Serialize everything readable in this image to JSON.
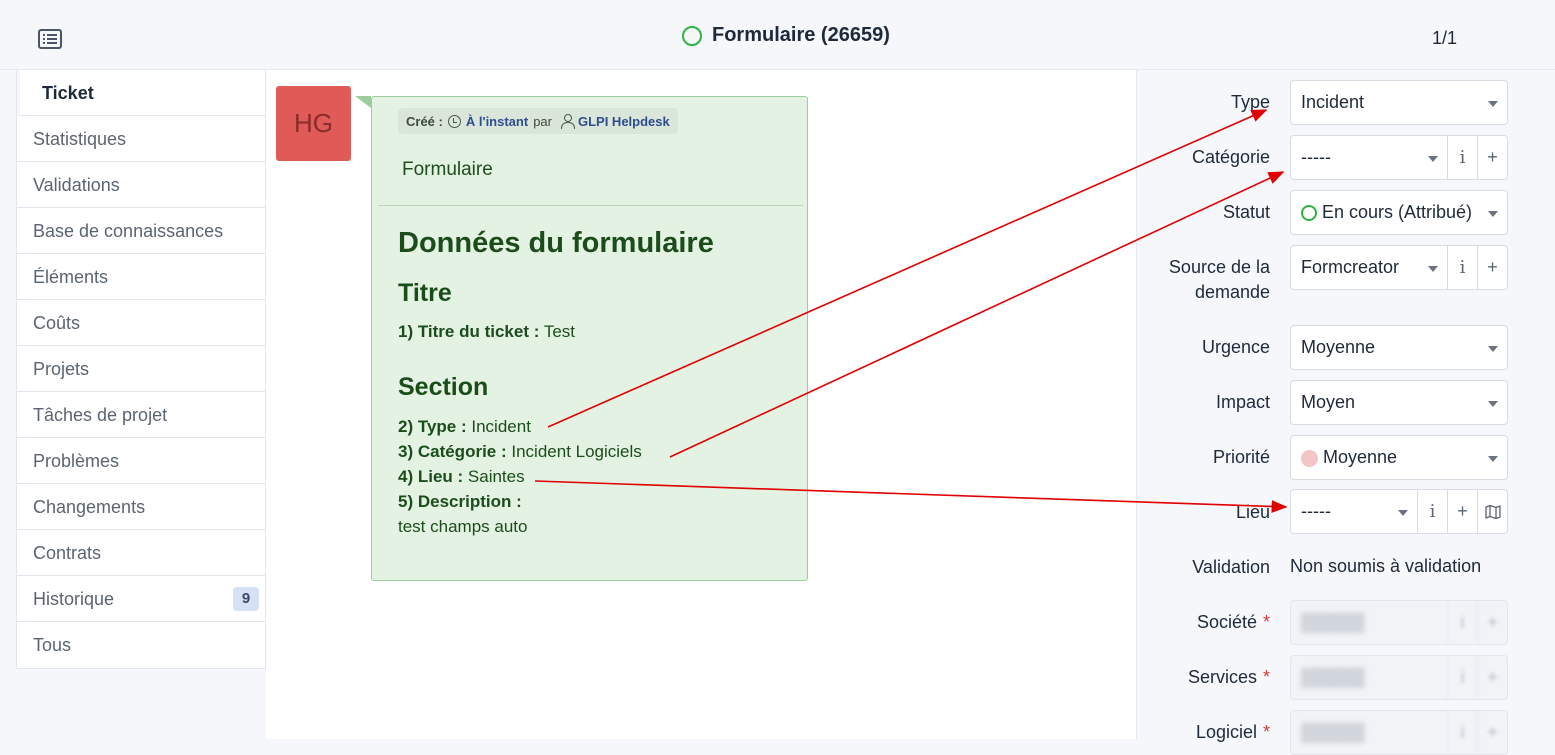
{
  "header": {
    "title": "Formulaire (26659)",
    "pager": "1/1"
  },
  "tabs": [
    {
      "label": "Ticket"
    },
    {
      "label": "Statistiques"
    },
    {
      "label": "Validations"
    },
    {
      "label": "Base de connaissances"
    },
    {
      "label": "Éléments"
    },
    {
      "label": "Coûts"
    },
    {
      "label": "Projets"
    },
    {
      "label": "Tâches de projet"
    },
    {
      "label": "Problèmes"
    },
    {
      "label": "Changements"
    },
    {
      "label": "Contrats"
    },
    {
      "label": "Historique",
      "badge": "9"
    },
    {
      "label": "Tous"
    }
  ],
  "timeline": {
    "avatar_initials": "HG",
    "meta": {
      "created_label": "Créé :",
      "when": "À l'instant",
      "by": "par",
      "author": "GLPI Helpdesk"
    },
    "name": "Formulaire",
    "heading": "Données du formulaire",
    "section1_title": "Titre",
    "q1_label": "1) Titre du ticket :",
    "q1_value": "Test",
    "section2_title": "Section",
    "q2_label": "2) Type :",
    "q2_value": "Incident",
    "q3_label": "3) Catégorie :",
    "q3_value": "Incident Logiciels",
    "q4_label": "4) Lieu :",
    "q4_value": "Saintes",
    "q5_label": "5) Description :",
    "q5_value": "test champs auto"
  },
  "fields": {
    "type": {
      "label": "Type",
      "value": "Incident"
    },
    "categorie": {
      "label": "Catégorie",
      "value": "-----"
    },
    "statut": {
      "label": "Statut",
      "value": "En cours (Attribué)"
    },
    "source": {
      "label": "Source de la demande",
      "value": "Formcreator"
    },
    "urgence": {
      "label": "Urgence",
      "value": "Moyenne"
    },
    "impact": {
      "label": "Impact",
      "value": "Moyen"
    },
    "priorite": {
      "label": "Priorité",
      "value": "Moyenne"
    },
    "lieu": {
      "label": "Lieu",
      "value": "-----"
    },
    "validation": {
      "label": "Validation",
      "value": "Non soumis à validation"
    },
    "societe": {
      "label": "Société",
      "required_mark": "*"
    },
    "services": {
      "label": "Services",
      "required_mark": "*"
    },
    "logiciel": {
      "label": "Logiciel",
      "required_mark": "*"
    }
  },
  "colors": {
    "status_green": "#2fb344",
    "avatar": "#e05a57",
    "bubble_bg": "#e4f2e4",
    "annotation_arrow": "#e00000"
  }
}
